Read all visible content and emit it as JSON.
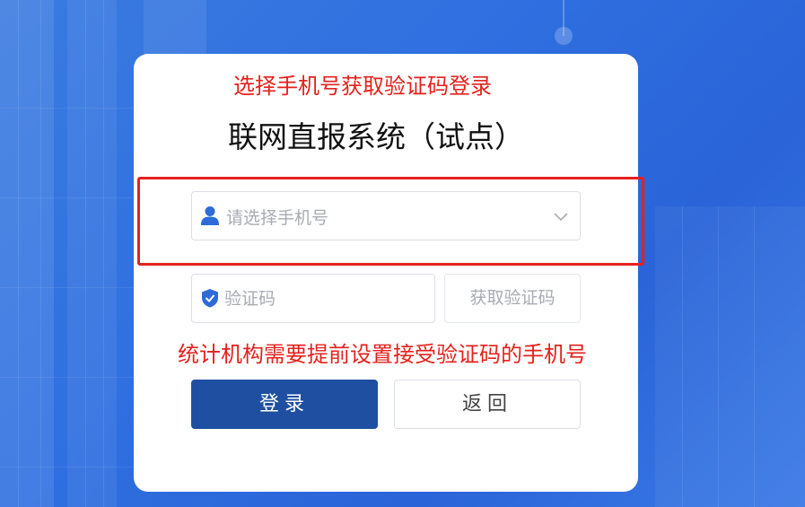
{
  "annotations": {
    "top": "选择手机号获取验证码登录",
    "middle": "统计机构需要提前设置接受验证码的手机号"
  },
  "title": "联网直报系统（试点）",
  "phone_select": {
    "placeholder": "请选择手机号",
    "icon": "user-icon"
  },
  "code_field": {
    "placeholder": "验证码",
    "icon": "shield-check-icon"
  },
  "get_code_label": "获取验证码",
  "login_label": "登录",
  "back_label": "返回",
  "colors": {
    "annotation": "#e4211c",
    "primary": "#1e4fa0",
    "icon": "#2e6bd8",
    "background": "#2f6fe0"
  }
}
